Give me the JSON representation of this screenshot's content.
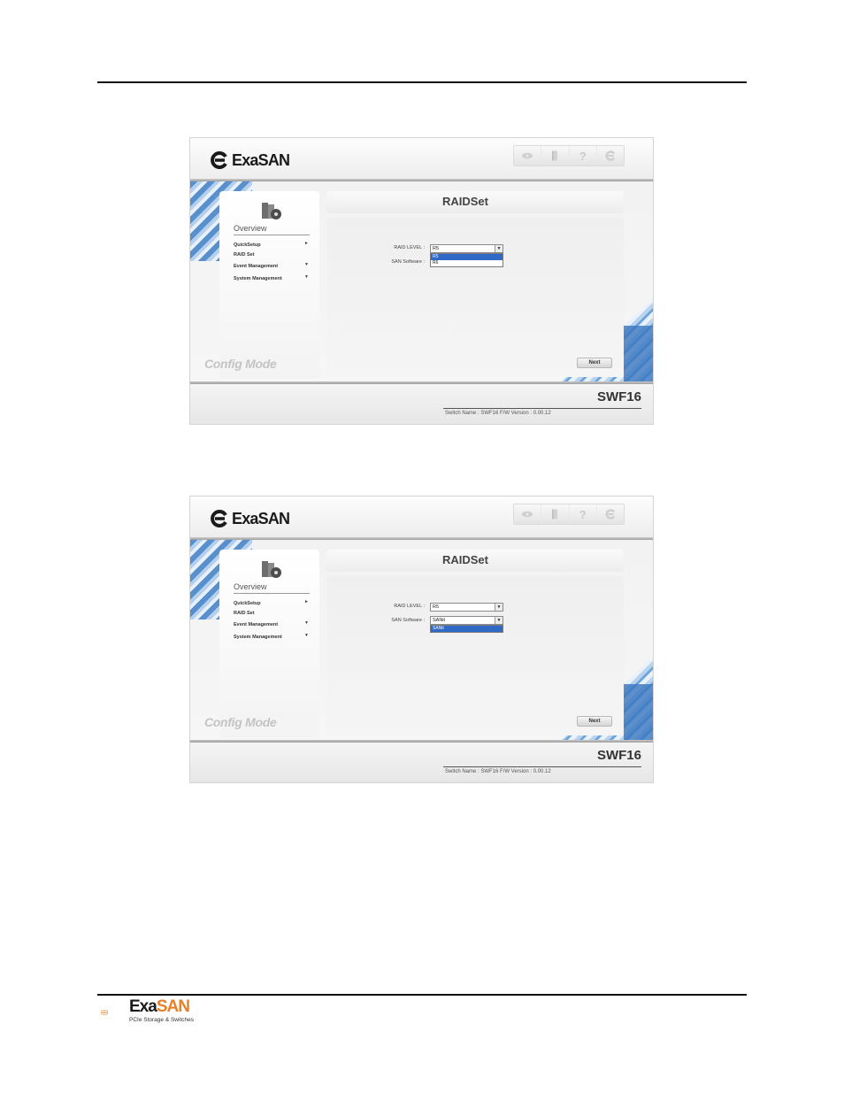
{
  "screens": [
    {
      "logo_text": "ExaSAN",
      "nav_header": "Overview",
      "nav_items": [
        "QuickSetup",
        "RAID Set",
        "Event Management",
        "System Management"
      ],
      "page_title": "RAIDSet",
      "fields": {
        "raid_level_label": "RAID LEVEL :",
        "raid_level_value": "R5",
        "san_software_label": "SAN Software :",
        "san_software_value": ""
      },
      "dropdown": {
        "field": "raid_level",
        "options": [
          "R5",
          "R6"
        ],
        "highlighted": "R5"
      },
      "mode_label": "Config Mode",
      "next_label": "Next",
      "model": "SWF16",
      "footer_info": "Switch Name : SWF16 F/W Version : 0.00.12"
    },
    {
      "logo_text": "ExaSAN",
      "nav_header": "Overview",
      "nav_items": [
        "QuickSetup",
        "RAID Set",
        "Event Management",
        "System Management"
      ],
      "page_title": "RAIDSet",
      "fields": {
        "raid_level_label": "RAID LEVEL :",
        "raid_level_value": "R5",
        "san_software_label": "SAN Software :",
        "san_software_value": "SANit"
      },
      "dropdown": {
        "field": "san_software",
        "options": [
          "SANit"
        ],
        "highlighted": "SANit"
      },
      "mode_label": "Config Mode",
      "next_label": "Next",
      "model": "SWF16",
      "footer_info": "Switch Name : SWF16 F/W Version : 0.00.12"
    }
  ],
  "footer_logo": {
    "brand_part1": "Exa",
    "brand_part2": "SAN",
    "tagline": "PCIe Storage & Switches",
    "accent_color": "#e8802a"
  },
  "icons": [
    "eye-icon",
    "book-icon",
    "help-icon",
    "exasan-icon"
  ]
}
